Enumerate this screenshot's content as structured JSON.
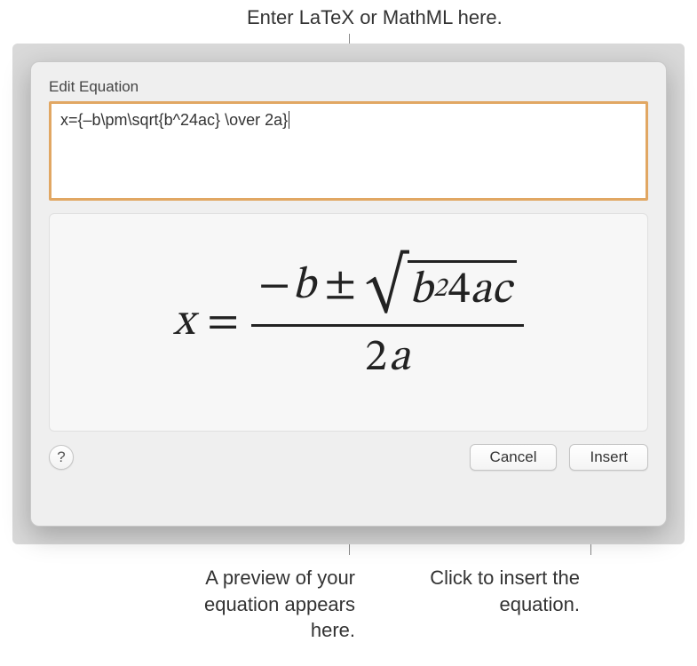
{
  "callouts": {
    "top": "Enter LaTeX or MathML here.",
    "bottom_left": "A preview of your equation appears here.",
    "bottom_right": "Click to insert the equation."
  },
  "dialog": {
    "title": "Edit Equation",
    "input_value": "x={–b\\pm\\sqrt{b^24ac} \\over 2a}",
    "buttons": {
      "help_label": "?",
      "cancel_label": "Cancel",
      "insert_label": "Insert"
    }
  },
  "preview": {
    "x": "x",
    "equals": "=",
    "minus": "−",
    "b": "b",
    "plusminus": "±",
    "radical": "√",
    "sup2": "2",
    "four": "4",
    "a": "a",
    "c": "c",
    "two": "2"
  }
}
